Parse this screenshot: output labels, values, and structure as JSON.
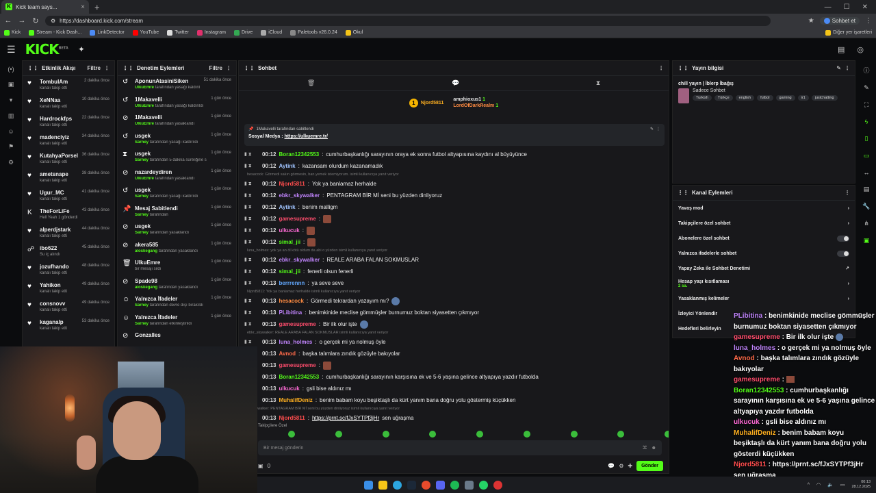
{
  "browser": {
    "tab_title": "Kick team says...",
    "url": "https://dashboard.kick.com/stream",
    "profile_label": "Sohbet et",
    "bookmarks": [
      "Kick",
      "Stream - Kick Dash...",
      "LinkDetector",
      "YouTube",
      "Twitter",
      "Instagram",
      "Drive",
      "iCloud",
      "Paletools v26.0.24",
      "Okul"
    ],
    "bookmarks_other": "Diğer yer işaretleri"
  },
  "colors": {
    "accent": "#53fc18",
    "panel": "#18181b",
    "bg": "#0b0c0e"
  },
  "activity": {
    "title": "Etkinlik Akışı",
    "filter": "Filtre",
    "items": [
      {
        "icon": "heart",
        "name": "TombulAm",
        "sub": "kanalı takip etti",
        "time": "2 dakika önce"
      },
      {
        "icon": "heart",
        "name": "XeNNaa",
        "sub": "kanalı takip etti",
        "time": "10 dakika önce"
      },
      {
        "icon": "heart",
        "name": "Hardrockfps",
        "sub": "kanalı takip etti",
        "time": "22 dakika önce"
      },
      {
        "icon": "heart",
        "name": "madenciyiz",
        "sub": "kanalı takip etti",
        "time": "34 dakika önce"
      },
      {
        "icon": "heart",
        "name": "KutahyaPorselennn",
        "sub": "kanalı takip etti",
        "time": "36 dakika önce"
      },
      {
        "icon": "heart",
        "name": "ametsnape",
        "sub": "kanalı takip etti",
        "time": "38 dakika önce"
      },
      {
        "icon": "heart",
        "name": "Ugur_MC",
        "sub": "kanalı takip etti",
        "time": "41 dakika önce"
      },
      {
        "icon": "kick",
        "name": "TheForLiFe",
        "sub": "Hell Yeah  1 gönderdi",
        "time": "43 dakika önce"
      },
      {
        "icon": "heart",
        "name": "alperdjstark",
        "sub": "kanalı takip etti",
        "time": "44 dakika önce"
      },
      {
        "icon": "users",
        "name": "ibo622",
        "sub": "Su iç alındı",
        "time": "45 dakika önce"
      },
      {
        "icon": "heart",
        "name": "jozufhando",
        "sub": "kanalı takip etti",
        "time": "48 dakika önce"
      },
      {
        "icon": "heart",
        "name": "Yahikon",
        "sub": "kanalı takip etti",
        "time": "49 dakika önce"
      },
      {
        "icon": "heart",
        "name": "consnovv",
        "sub": "kanalı takip etti",
        "time": "49 dakika önce"
      },
      {
        "icon": "heart",
        "name": "kaganalp",
        "sub": "kanalı takip etti",
        "time": "53 dakika önce"
      }
    ]
  },
  "moderation": {
    "title": "Denetim Eylemleri",
    "filter": "Filtre",
    "items": [
      {
        "icon": "undo",
        "name": "AponunAtasiniSiken",
        "by": "UlkuEmre",
        "sub": "tarafından yasağı kaldırıldı",
        "time": "51 dakika önce"
      },
      {
        "icon": "undo",
        "name": "1Makavelli",
        "by": "UlkuEmre",
        "sub": "tarafından yasağı kaldırıldı",
        "time": "1 gün önce"
      },
      {
        "icon": "ban",
        "name": "1Makavelli",
        "by": "UlkuEmre",
        "sub": "tarafından yasaklandı",
        "time": "1 gün önce"
      },
      {
        "icon": "undo",
        "name": "usgek",
        "by": "Sarney",
        "sub": "tarafından yasağı kaldırıldı",
        "time": "1 gün önce"
      },
      {
        "icon": "timer",
        "name": "usgek",
        "by": "Sarney",
        "sub": "tarafından 5 dakika süreliğine sohbetten uzaklaştırıldı",
        "time": "1 gün önce"
      },
      {
        "icon": "ban",
        "name": "nazardeydiren",
        "by": "UlkuEmre",
        "sub": "tarafından yasaklandı",
        "time": "1 gün önce"
      },
      {
        "icon": "undo",
        "name": "usgek",
        "by": "Sarney",
        "sub": "tarafından yasağı kaldırıldı",
        "time": "1 gün önce"
      },
      {
        "icon": "pin",
        "name": "Mesaj Sabitlendi",
        "by": "Sarney",
        "sub": "tarafından",
        "time": "1 gün önce"
      },
      {
        "icon": "ban",
        "name": "usgek",
        "by": "Sarney",
        "sub": "tarafından yasaklandı",
        "time": "1 gün önce"
      },
      {
        "icon": "ban",
        "name": "akera585",
        "by": "aloskegang",
        "sub": "tarafından yasaklandı",
        "time": "1 gün önce"
      },
      {
        "icon": "trash",
        "name": "UlkuEmre",
        "by": "",
        "sub": "bir mesajı sildi",
        "time": "1 gün önce"
      },
      {
        "icon": "ban",
        "name": "Spade98",
        "by": "aloskegang",
        "sub": "tarafından yasaklandı",
        "time": "1 gün önce"
      },
      {
        "icon": "smile",
        "name": "Yalnızca İfadeler",
        "by": "Sarney",
        "sub": "tarafından devre dışı bırakıldı",
        "time": "1 gün önce"
      },
      {
        "icon": "smile",
        "name": "Yalnızca İfadeler",
        "by": "Sarney",
        "sub": "tarafından etkinleştirildi",
        "time": "1 gün önce"
      },
      {
        "icon": "ban",
        "name": "Gonzalles",
        "by": "",
        "sub": "",
        "time": ""
      }
    ]
  },
  "chat": {
    "title": "Sohbet",
    "leaderboard": [
      {
        "rank": "1",
        "name": "Njord5811",
        "count": "1"
      },
      {
        "rank": "",
        "name": "amphioxus1",
        "count": "1"
      },
      {
        "rank": "",
        "name": "LordOfDarkRealm",
        "count": "1"
      }
    ],
    "pinned": {
      "header": "1Makavelli tarafından sabitlendi",
      "label": "Sosyal Medya :",
      "link": "https://ulkuemre.tr/"
    },
    "messages": [
      {
        "type": "msg",
        "time": "00:12",
        "user": "Boran12342553",
        "color": "#53fc18",
        "text": "cumhurbaşkanlığı sarayının oraya ek sonra futbol altyapısına kaydını al büyüyünce"
      },
      {
        "type": "msg",
        "time": "00:12",
        "user": "Aytink",
        "color": "#a0c4ff",
        "text": "kazansam olurdum kazanamadık"
      },
      {
        "type": "reply",
        "text": "hesacock: Görmedi sakın görmesin, ban yemek istemiyorum. isimli kullanıcıya yanıt veriyor"
      },
      {
        "type": "msg",
        "time": "00:12",
        "user": "Njord5811",
        "color": "#ff4d4d",
        "text": "Yok ya banlamaz herhalde"
      },
      {
        "type": "msg",
        "time": "00:12",
        "user": "ebkr_skywalker",
        "color": "#c084fc",
        "text": "PENTAGRAM BİR Mİ seni bu yüzden dinliyoruz"
      },
      {
        "type": "msg",
        "time": "00:12",
        "user": "Aytink",
        "color": "#a0c4ff",
        "text": "benim malligm"
      },
      {
        "type": "msg",
        "time": "00:12",
        "user": "gamesupreme",
        "color": "#ff4d6d",
        "text": "",
        "emote": true
      },
      {
        "type": "msg",
        "time": "00:12",
        "user": "ulkucuk",
        "color": "#ff6bd6",
        "text": "",
        "emote": true
      },
      {
        "type": "msg",
        "time": "00:12",
        "user": "simal_jii",
        "color": "#53fc18",
        "text": "",
        "emote": true
      },
      {
        "type": "reply",
        "text": "luna_holmes: yok ya an öl kötü oldum da abi o yüzden isimli kullanıcıya yanıt veriyor"
      },
      {
        "type": "msg",
        "time": "00:12",
        "user": "ebkr_skywalker",
        "color": "#c084fc",
        "text": "REALE ARABA FALAN SOKMUSLAR"
      },
      {
        "type": "msg",
        "time": "00:12",
        "user": "simal_jii",
        "color": "#53fc18",
        "text": "fenerli olsun fenerli"
      },
      {
        "type": "msg",
        "time": "00:13",
        "user": "berrrennn",
        "color": "#60a5fa",
        "text": "ya seve seve"
      },
      {
        "type": "reply",
        "text": "Njord5811: Yok ya banlamaz herhalde isimli kullanıcıya yanıt veriyor"
      },
      {
        "type": "msg",
        "time": "00:13",
        "user": "hesacock",
        "color": "#ff8c42",
        "text": "Görmedi tekrardan yazayım mı?",
        "globe": true
      },
      {
        "type": "msg",
        "time": "00:13",
        "user": "PLibitina",
        "color": "#c084fc",
        "text": "benimkinide meclise gömmüşler burnumuz boktan siyasetten çıkmıyor"
      },
      {
        "type": "msg",
        "time": "00:13",
        "user": "gamesupreme",
        "color": "#ff4d6d",
        "text": "Bir ilk olur işte",
        "globe": true
      },
      {
        "type": "reply",
        "text": "ebkr_skywalker: REALE ARABA FALAN SOKMUSLAR isimli kullanıcıya yanıt veriyor"
      },
      {
        "type": "msg",
        "time": "00:13",
        "user": "luna_holmes",
        "color": "#c084fc",
        "text": "o gerçek mi ya nolmuş öyle"
      },
      {
        "type": "msg",
        "time": "00:13",
        "user": "Avnod",
        "color": "#ff6b4a",
        "text": "başka talımlara zındık gözüyle bakıyolar"
      },
      {
        "type": "msg",
        "time": "00:13",
        "user": "gamesupreme",
        "color": "#ff4d6d",
        "text": "",
        "emote": true
      },
      {
        "type": "msg",
        "time": "00:13",
        "user": "Boran12342553",
        "color": "#53fc18",
        "text": "cumhurbaşkanlığı sarayının karşısına ek ve 5-6 yaşına gelince altyapıya yazdır futbolda"
      },
      {
        "type": "msg",
        "time": "00:13",
        "user": "ulkucuk",
        "color": "#ff6bd6",
        "text": "gsli bise aldınız mı"
      },
      {
        "type": "msg",
        "time": "00:13",
        "user": "MuhalifDeniz",
        "color": "#ffb020",
        "text": "benim babam koyu beşiktaşlı da kürt yanım bana doğru yolu göstermiş küçükken"
      },
      {
        "type": "reply",
        "text": "ic_skywalker: PENTAGRAM BİR Mİ seni bu yüzden dinliyoruz isimli kullanıcıya yanıt veriyor"
      },
      {
        "type": "msg",
        "time": "00:13",
        "user": "Njord5811",
        "color": "#ff4d4d",
        "text": "",
        "link": "https://prnt.sc/fJxSYTPf3jHr",
        "after": "sen uğraşma"
      }
    ],
    "section_label": "Takipçilere Özel",
    "input_placeholder": "Bir mesaj gönderin",
    "points": "0",
    "send": "Gönder"
  },
  "stream_info": {
    "title": "Yayın bilgisi",
    "stream_title": "chill yayın | İblerp İbağış",
    "sub": "Sadece Sohbet",
    "tags": [
      "Turkish",
      "Türkçe",
      "english",
      "futbol",
      "gaming",
      "ir1",
      "justchatting"
    ]
  },
  "channel_actions": {
    "title": "Kanal Eylemleri",
    "items": [
      {
        "label": "Yavaş mod",
        "ctrl": "arrow",
        "sub": ""
      },
      {
        "label": "Takipçilere özel sohbet",
        "ctrl": "arrow",
        "sub": ""
      },
      {
        "label": "Abonelere özel sohbet",
        "ctrl": "toggle",
        "sub": ""
      },
      {
        "label": "Yalnızca ifadelerle sohbet",
        "ctrl": "toggle",
        "sub": ""
      },
      {
        "label": "Yapay Zeka ile Sohbet Denetimi",
        "ctrl": "external",
        "sub": ""
      },
      {
        "label": "Hesap yaşı kısıtlaması",
        "ctrl": "arrow",
        "sub": "2 sa."
      },
      {
        "label": "Yasaklanmış kelimeler",
        "ctrl": "arrow",
        "sub": ""
      },
      {
        "label": "İzleyici Yönlendir",
        "ctrl": "",
        "sub": ""
      },
      {
        "label": "Hedefleri belirleyin",
        "ctrl": "",
        "sub": ""
      }
    ]
  },
  "overlay_chat": [
    {
      "user": "PLibitina",
      "color": "#c084fc",
      "text": " : benimkinide meclise gömmüşler burnumuz boktan siyasetten çıkmıyor"
    },
    {
      "user": "gamesupreme",
      "color": "#ff4d6d",
      "text": " : Bir ilk olur işte",
      "globe": true
    },
    {
      "user": "luna_holmes",
      "color": "#c084fc",
      "text": " : o gerçek mi ya nolmuş öyle"
    },
    {
      "user": "Avnod",
      "color": "#ff6b4a",
      "text": " : başka talımlara zındık gözüyle bakıyolar"
    },
    {
      "user": "gamesupreme",
      "color": "#ff4d6d",
      "text": " :",
      "emote": true
    },
    {
      "user": "Boran12342553",
      "color": "#53fc18",
      "text": " : cumhurbaşkanlığı sarayının karşısına ek ve 5-6 yaşına gelince altyapıya yazdır futbolda"
    },
    {
      "user": "ulkucuk",
      "color": "#ff6bd6",
      "text": " : gsli bise aldınız mı"
    },
    {
      "user": "MuhalifDeniz",
      "color": "#ffb020",
      "text": " : benim babam koyu beşiktaşlı da kürt yanım bana doğru yolu gösterdi küçükken"
    },
    {
      "user": "Njord5811",
      "color": "#ff4d4d",
      "text": " : https://prnt.sc/fJxSYTPf3jHr sen uğraşma"
    }
  ],
  "taskbar": {
    "time": "00:13",
    "date": "28.12.2025"
  }
}
